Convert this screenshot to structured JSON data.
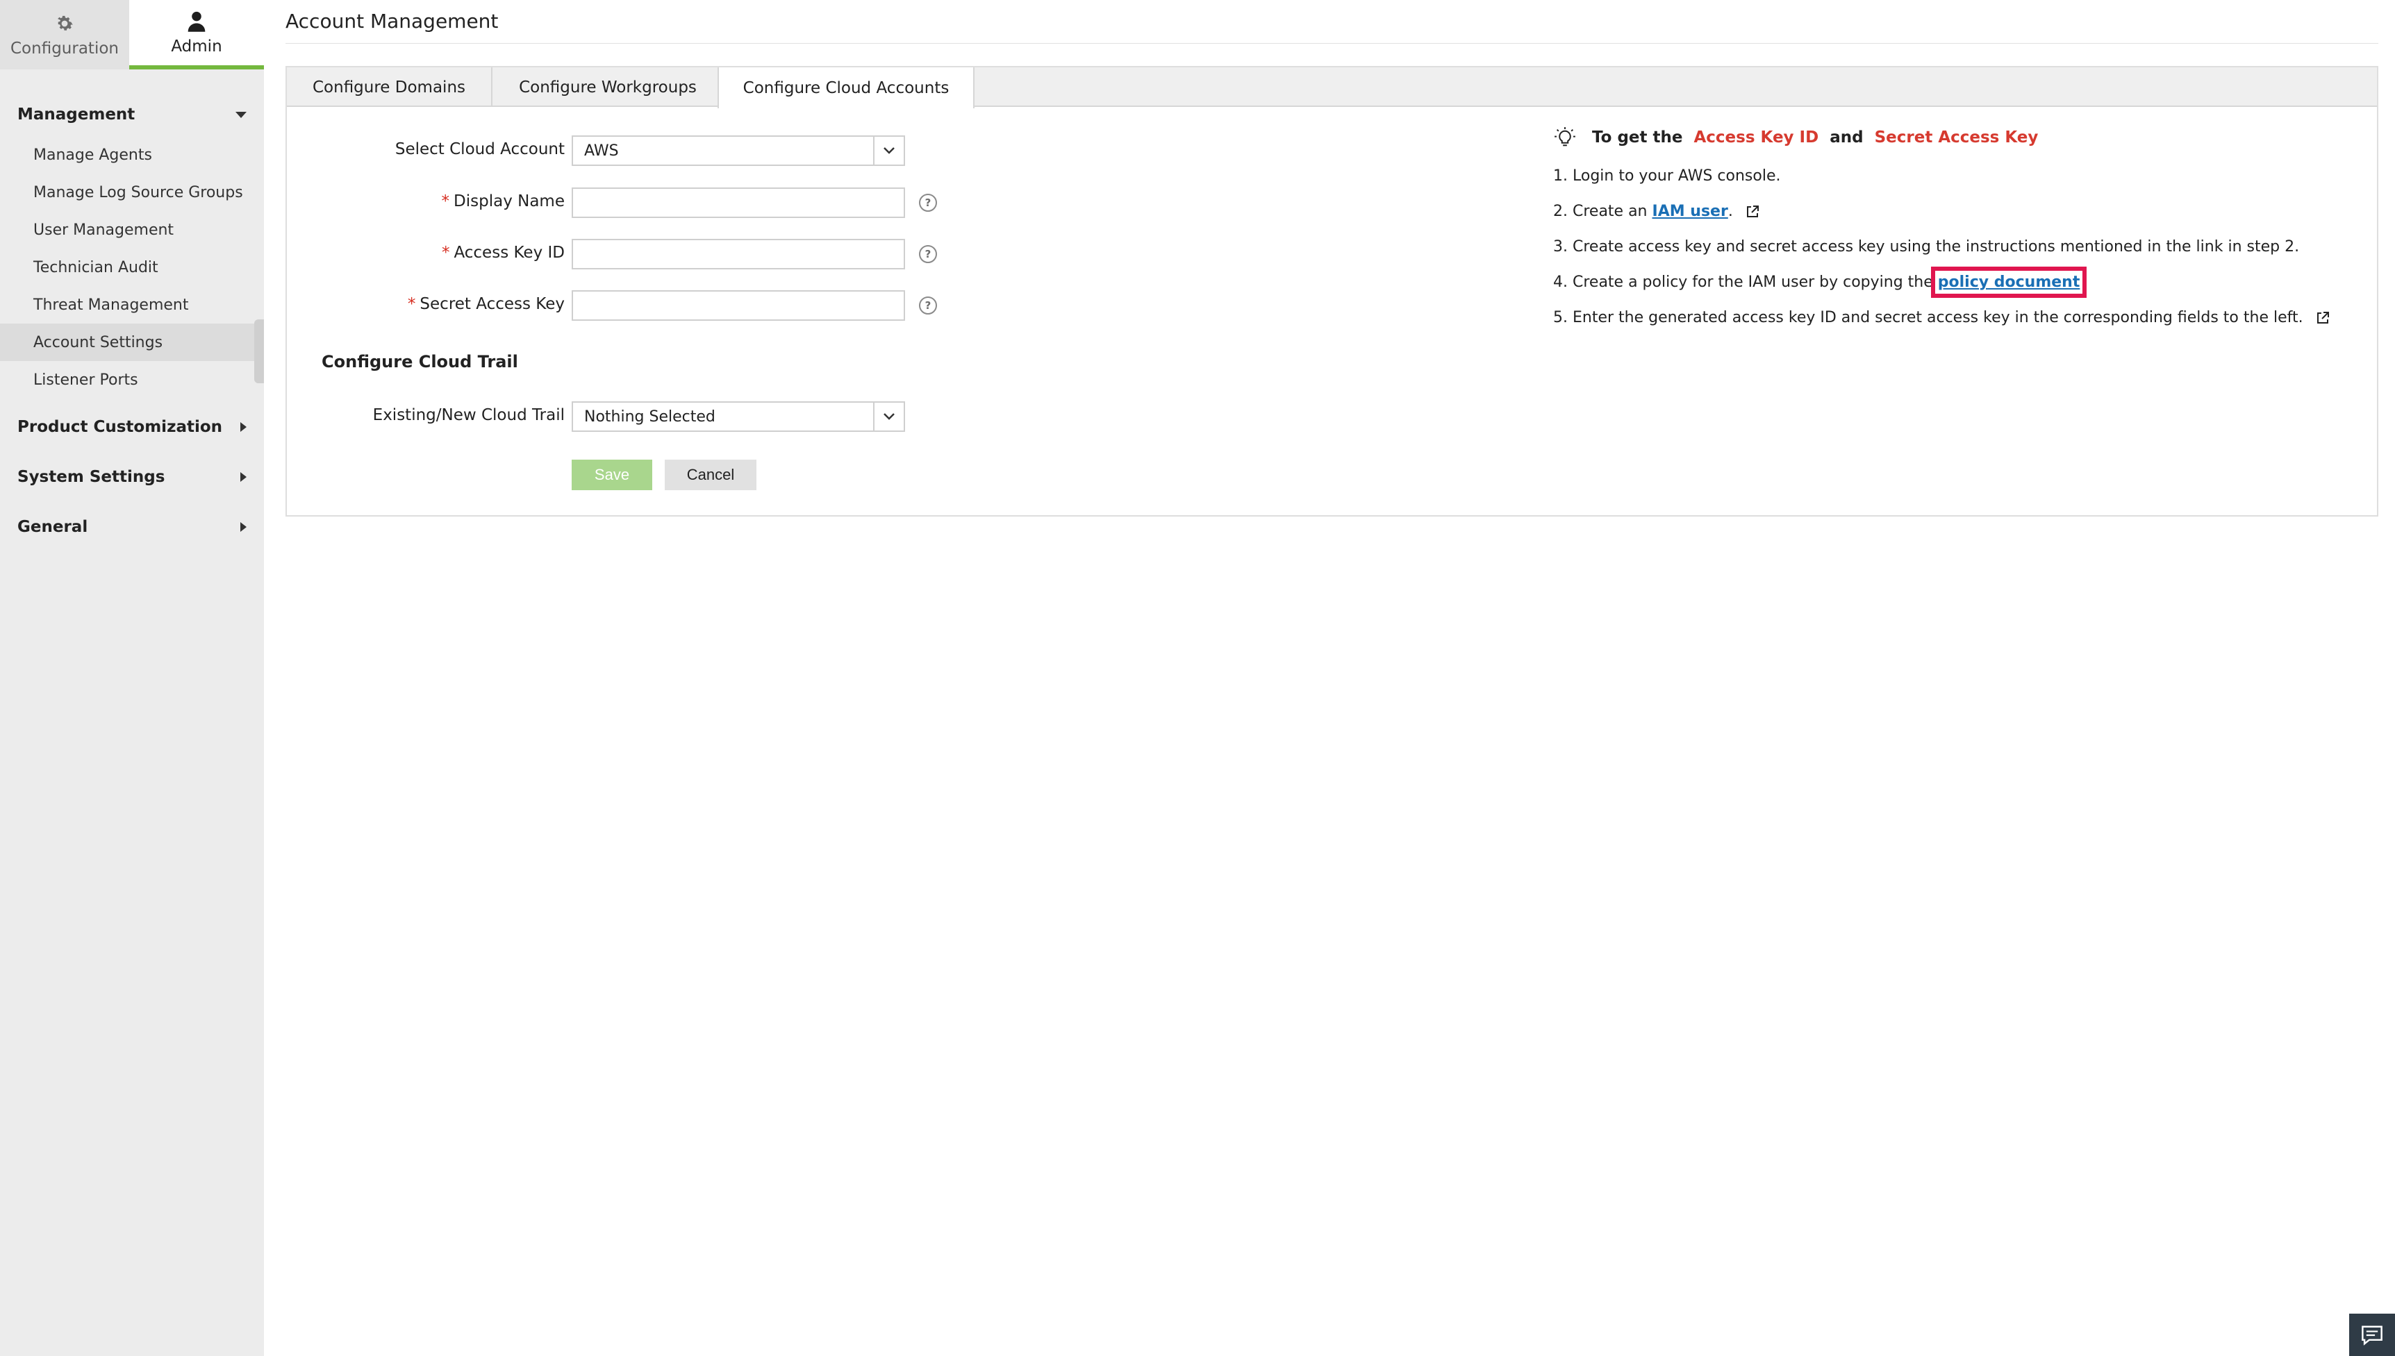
{
  "top_tabs": {
    "configuration": "Configuration",
    "admin": "Admin"
  },
  "sidebar": {
    "management": "Management",
    "items": [
      {
        "label": "Manage Agents"
      },
      {
        "label": "Manage Log Source Groups"
      },
      {
        "label": "User Management"
      },
      {
        "label": "Technician Audit"
      },
      {
        "label": "Threat Management"
      },
      {
        "label": "Account Settings"
      },
      {
        "label": "Listener Ports"
      }
    ],
    "product_customization": "Product Customization",
    "system_settings": "System Settings",
    "general": "General"
  },
  "page": {
    "title": "Account Management"
  },
  "tabs": [
    {
      "label": "Configure Domains"
    },
    {
      "label": "Configure Workgroups"
    },
    {
      "label": "Configure Cloud Accounts"
    }
  ],
  "form": {
    "select_cloud_account_label": "Select Cloud Account",
    "select_cloud_account_value": "AWS",
    "display_name_label": "Display Name",
    "display_name_value": "",
    "access_key_label": "Access Key ID",
    "access_key_value": "",
    "secret_key_label": "Secret Access Key",
    "secret_key_value": "",
    "required_mark": "*",
    "help_glyph": "?",
    "cloud_trail_section": "Configure Cloud Trail",
    "cloud_trail_label": "Existing/New Cloud Trail",
    "cloud_trail_value": "Nothing Selected",
    "save": "Save",
    "cancel": "Cancel"
  },
  "instructions": {
    "head_prefix": "To get the",
    "access_key": "Access Key ID",
    "and": "and",
    "secret_key": "Secret Access Key",
    "step1": "1. Login to your AWS console.",
    "step2_prefix": "2. Create an",
    "step2_link": "IAM user",
    "step2_suffix": ".",
    "step3": "3. Create access key and secret access key using the instructions mentioned in the link in step 2.",
    "step4_prefix": "4. Create a policy for the IAM user by copying the",
    "step4_link": "policy document",
    "step5": "5. Enter the generated access key ID and secret access key in the corresponding fields to the left."
  },
  "colors": {
    "accent_green": "#74b83e",
    "required_red": "#d62d20",
    "highlight": "#e0164f",
    "link_blue": "#1a6fb5"
  }
}
